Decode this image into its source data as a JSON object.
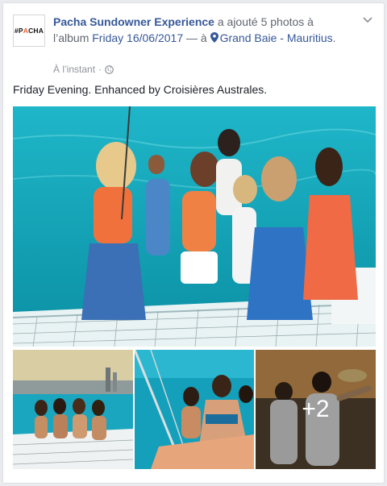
{
  "post": {
    "page_name": "Pacha Sundowner Experience",
    "action_text": " a ajouté 5 photos à l’album ",
    "album_name": "Friday 16/06/2017",
    "location_prefix": " — à ",
    "location": "Grand Baie - Mauritius",
    "location_suffix": ".",
    "timestamp": "À l’instant",
    "separator": "·",
    "caption": "Friday Evening. Enhanced by Croisières Australes.",
    "avatar_text_prefix": "#P",
    "avatar_text_accent": "A",
    "avatar_text_suffix": "CHA",
    "more_photos": "+2"
  },
  "icons": {
    "audience": "globe-icon",
    "menu": "chevron-down-icon",
    "location": "map-pin-icon"
  },
  "colors": {
    "link": "#365899",
    "secondary_text": "#616770",
    "meta_text": "#90949c",
    "avatar_accent": "#e8622c"
  }
}
